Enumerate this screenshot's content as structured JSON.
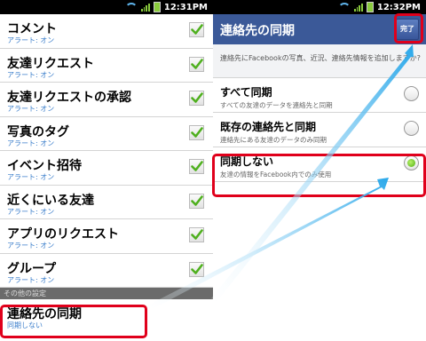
{
  "status_left": {
    "time": "12:31PM"
  },
  "status_right": {
    "time": "12:32PM"
  },
  "left": {
    "items": [
      {
        "title": "コメント",
        "sub": "アラート: オン"
      },
      {
        "title": "友達リクエスト",
        "sub": "アラート: オン"
      },
      {
        "title": "友達リクエストの承認",
        "sub": "アラート: オン"
      },
      {
        "title": "写真のタグ",
        "sub": "アラート: オン"
      },
      {
        "title": "イベント招待",
        "sub": "アラート: オン"
      },
      {
        "title": "近くにいる友達",
        "sub": "アラート: オン"
      },
      {
        "title": "アプリのリクエスト",
        "sub": "アラート: オン"
      },
      {
        "title": "グループ",
        "sub": "アラート: オン"
      }
    ],
    "section": "その他の設定",
    "sync": {
      "title": "連絡先の同期",
      "sub": "同期しない"
    }
  },
  "right": {
    "title": "連絡先の同期",
    "done": "完了",
    "description": "連絡先にFacebookの写真、近況、連絡先情報を追加しますか?",
    "options": [
      {
        "title": "すべて同期",
        "sub": "すべての友達のデータを連絡先と同期",
        "selected": false
      },
      {
        "title": "既存の連絡先と同期",
        "sub": "連絡先にある友達のデータのみ同期",
        "selected": false
      },
      {
        "title": "同期しない",
        "sub": "友達の情報をFacebook内でのみ使用",
        "selected": true
      }
    ]
  },
  "colors": {
    "facebook_blue": "#3b5998",
    "highlight_red": "#e0001b",
    "arrow_blue": "#3fb2ec"
  }
}
